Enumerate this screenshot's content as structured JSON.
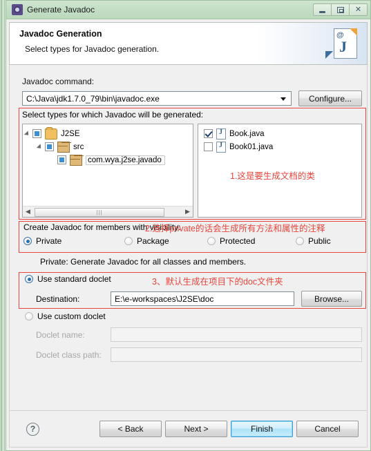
{
  "window": {
    "title": "Generate Javadoc",
    "title_icon": "gear-icon",
    "minimize_label": "Minimize",
    "restore_label": "Restore",
    "close_label": "Close",
    "close_glyph": "✕"
  },
  "header": {
    "title": "Javadoc Generation",
    "subtitle": "Select types for Javadoc generation.",
    "icon": "javadoc-page-icon",
    "icon_at": "@",
    "icon_letter": "J"
  },
  "command": {
    "label": "Javadoc command:",
    "value": "C:\\Java\\jdk1.7.0_79\\bin\\javadoc.exe",
    "configure_label": "Configure..."
  },
  "types_group": {
    "label": "Select types for which Javadoc will be generated:",
    "tree": [
      {
        "label": "J2SE",
        "icon": "project-folder-icon",
        "check": "partial",
        "depth": 0,
        "expanded": true
      },
      {
        "label": "src",
        "icon": "source-folder-icon",
        "check": "partial",
        "depth": 1,
        "expanded": true
      },
      {
        "label": "com.wya.j2se.javado",
        "icon": "package-icon",
        "check": "partial",
        "depth": 2,
        "expanded": false,
        "selected": true
      }
    ],
    "files": [
      {
        "label": "Book.java",
        "icon": "java-file-icon",
        "check": "checked"
      },
      {
        "label": "Book01.java",
        "icon": "java-file-icon",
        "check": "unchecked"
      }
    ],
    "annotation": "1.这是要生成文档的类",
    "scroll_left_glyph": "◀",
    "scroll_right_glyph": "▶",
    "scroll_grip": "|||"
  },
  "visibility_group": {
    "label": "Create Javadoc for members with visibility:",
    "options": [
      {
        "label": "Private",
        "selected": true
      },
      {
        "label": "Package",
        "selected": false
      },
      {
        "label": "Protected",
        "selected": false
      },
      {
        "label": "Public",
        "selected": false
      }
    ],
    "description": "Private: Generate Javadoc for all classes and members.",
    "annotation": "2.选择private的话会生成所有方法和属性的注释"
  },
  "doclet": {
    "standard_label": "Use standard doclet",
    "standard_selected": true,
    "destination_label": "Destination:",
    "destination_value": "E:\\e-workspaces\\J2SE\\doc",
    "browse_label": "Browse...",
    "custom_label": "Use custom doclet",
    "custom_selected": false,
    "doclet_name_label": "Doclet name:",
    "doclet_name_value": "",
    "doclet_class_path_label": "Doclet class path:",
    "doclet_class_path_value": "",
    "annotation": "3、默认生成在项目下的doc文件夹"
  },
  "footer": {
    "help_glyph": "?",
    "back_label": "< Back",
    "next_label": "Next >",
    "finish_label": "Finish",
    "cancel_label": "Cancel"
  },
  "colors": {
    "titlebar": "#c2ddc4",
    "annotation_red": "#e8453c",
    "default_button_border": "#3c9fd4",
    "dialog_bg": "#eff0ef"
  }
}
